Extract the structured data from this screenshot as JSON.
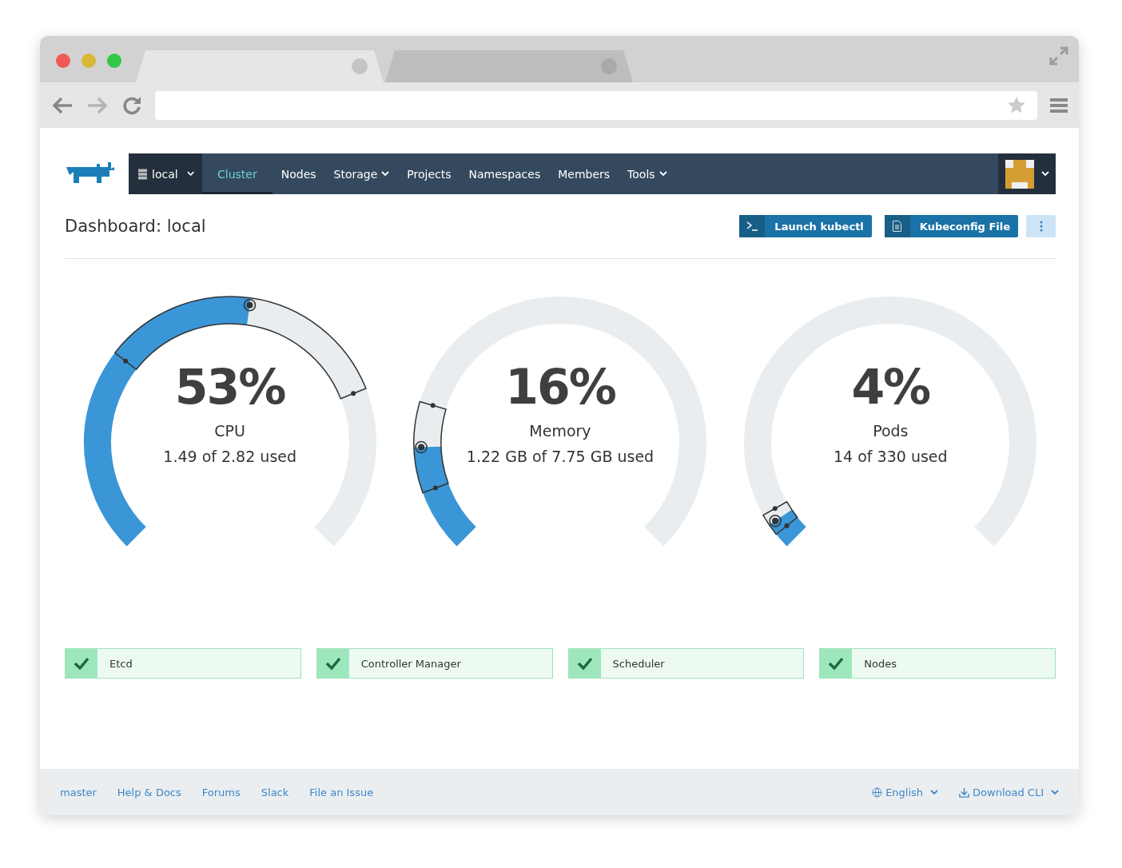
{
  "browser": {
    "tabs": [
      {
        "selected": true
      },
      {
        "selected": false
      }
    ]
  },
  "nav": {
    "cluster": "local",
    "items": [
      {
        "label": "Cluster",
        "selected": true,
        "dropdown": false
      },
      {
        "label": "Nodes",
        "selected": false,
        "dropdown": false
      },
      {
        "label": "Storage",
        "selected": false,
        "dropdown": true
      },
      {
        "label": "Projects",
        "selected": false,
        "dropdown": false
      },
      {
        "label": "Namespaces",
        "selected": false,
        "dropdown": false
      },
      {
        "label": "Members",
        "selected": false,
        "dropdown": false
      },
      {
        "label": "Tools",
        "selected": false,
        "dropdown": true
      }
    ]
  },
  "header": {
    "title": "Dashboard: local",
    "buttons": [
      {
        "kind": "terminal",
        "label": "Launch kubectl"
      },
      {
        "kind": "file",
        "label": "Kubeconfig File"
      }
    ]
  },
  "gauges": [
    {
      "percent": "53%",
      "name": "CPU",
      "usage": "1.49 of 2.82 used",
      "level": 0.53
    },
    {
      "percent": "16%",
      "name": "Memory",
      "usage": "1.22 GB of 7.75 GB used",
      "level": 0.16
    },
    {
      "percent": "4%",
      "name": "Pods",
      "usage": "14 of 330 used",
      "level": 0.04
    }
  ],
  "components": [
    {
      "label": "Etcd",
      "healthy": true
    },
    {
      "label": "Controller Manager",
      "healthy": true
    },
    {
      "label": "Scheduler",
      "healthy": true
    },
    {
      "label": "Nodes",
      "healthy": true
    }
  ],
  "footer": {
    "links": [
      "master",
      "Help & Docs",
      "Forums",
      "Slack",
      "File an Issue"
    ],
    "language": "English",
    "download": "Download CLI"
  }
}
